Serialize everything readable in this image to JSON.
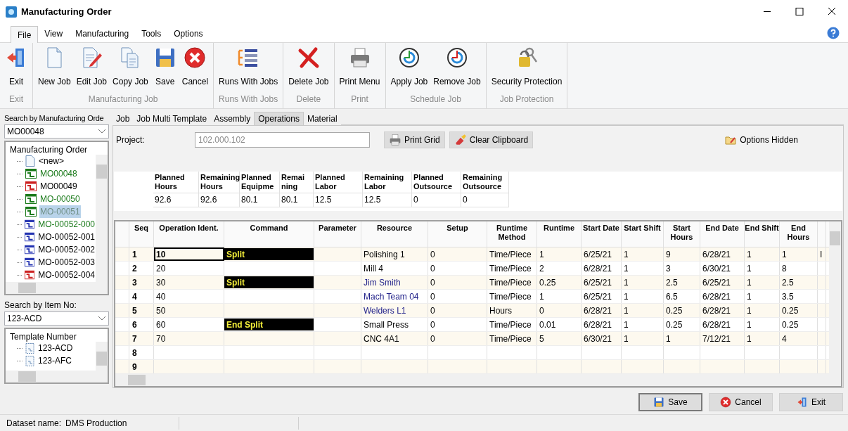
{
  "window": {
    "title": "Manufacturing Order"
  },
  "menu_tabs": [
    {
      "label": "File",
      "selected": true
    },
    {
      "label": "View",
      "selected": false
    },
    {
      "label": "Manufacturing",
      "selected": false
    },
    {
      "label": "Tools",
      "selected": false
    },
    {
      "label": "Options",
      "selected": false
    }
  ],
  "ribbon_groups": [
    {
      "title": "Exit",
      "buttons": [
        {
          "label": "Exit",
          "kind": "exit"
        }
      ]
    },
    {
      "title": "Manufacturing Job",
      "buttons": [
        {
          "label": "New Job",
          "kind": "new"
        },
        {
          "label": "Edit Job",
          "kind": "edit"
        },
        {
          "label": "Copy Job",
          "kind": "copy"
        },
        {
          "label": "Save",
          "kind": "save"
        },
        {
          "label": "Cancel",
          "kind": "cancel"
        }
      ]
    },
    {
      "title": "Runs With Jobs",
      "buttons": [
        {
          "label": "Runs With Jobs",
          "kind": "runs"
        }
      ]
    },
    {
      "title": "Delete",
      "buttons": [
        {
          "label": "Delete Job",
          "kind": "delete"
        }
      ]
    },
    {
      "title": "Print",
      "buttons": [
        {
          "label": "Print Menu",
          "kind": "print"
        }
      ]
    },
    {
      "title": "Schedule Job",
      "buttons": [
        {
          "label": "Apply Job",
          "kind": "apply"
        },
        {
          "label": "Remove Job",
          "kind": "remove"
        }
      ]
    },
    {
      "title": "Job Protection",
      "buttons": [
        {
          "label": "Security Protection",
          "kind": "security"
        }
      ]
    }
  ],
  "sidebar": {
    "order_search": {
      "label": "Search by Manufacturing Orde",
      "value": "MO00048"
    },
    "order_tree": {
      "title": "Manufacturing Order",
      "items": [
        {
          "label": "<new>",
          "kind": "new",
          "selected": false,
          "highlighted": false
        },
        {
          "label": "MO00048",
          "kind": "order",
          "color": "#1a7a1a",
          "selected": false,
          "highlighted": true
        },
        {
          "label": "MO00049",
          "kind": "order",
          "color": "#cc1f1f",
          "selected": false,
          "highlighted": false
        },
        {
          "label": "MO-00050",
          "kind": "order",
          "color": "#1a7a1a",
          "selected": false,
          "highlighted": true
        },
        {
          "label": "MO-00051",
          "kind": "order",
          "color": "#1a7a1a",
          "selected": true,
          "highlighted": true
        },
        {
          "label": "MO-00052-000",
          "kind": "order",
          "color": "#1f2fb0",
          "selected": false,
          "highlighted": true
        },
        {
          "label": "MO-00052-001",
          "kind": "order",
          "color": "#1f2fb0",
          "selected": false,
          "highlighted": false
        },
        {
          "label": "MO-00052-002",
          "kind": "order",
          "color": "#1f2fb0",
          "selected": false,
          "highlighted": false
        },
        {
          "label": "MO-00052-003",
          "kind": "order",
          "color": "#1f2fb0",
          "selected": false,
          "highlighted": false
        },
        {
          "label": "MO-00052-004",
          "kind": "order",
          "color": "#cc1f1f",
          "selected": false,
          "highlighted": false
        }
      ]
    },
    "item_search": {
      "label": "Search by Item No:",
      "value": "123-ACD"
    },
    "template_tree": {
      "title": "Template Number",
      "items": [
        "123-ACD",
        "123-AFC"
      ]
    }
  },
  "tabs": [
    {
      "label": "Job",
      "selected": false
    },
    {
      "label": "Job Multi Template",
      "selected": false
    },
    {
      "label": "Assembly",
      "selected": false
    },
    {
      "label": "Operations",
      "selected": true
    },
    {
      "label": "Material",
      "selected": false
    }
  ],
  "project": {
    "label": "Project:",
    "placeholder": "102.000.102"
  },
  "toolbar_buttons": [
    {
      "label": "Print Grid",
      "kind": "print"
    },
    {
      "label": "Clear Clipboard",
      "kind": "clear"
    }
  ],
  "options_link": "Options Hidden",
  "summary": {
    "columns": [
      "Planned Hours",
      "Remaining Hours",
      "Planned Equipme",
      "Remai ning",
      "Planned Labor",
      "Remaining Labor",
      "Planned Outsource",
      "Remaining Outsource"
    ],
    "values": [
      "92.6",
      "92.6",
      "80.1",
      "80.1",
      "12.5",
      "12.5",
      "0",
      "0"
    ]
  },
  "grid": {
    "columns": [
      "Seq",
      "Operation Ident.",
      "Command",
      "Parameter",
      "Resource",
      "Setup",
      "Runtime Method",
      "Runtime",
      "Start Date",
      "Start Shift",
      "Start Hours",
      "End Date",
      "End Shift",
      "End Hours"
    ],
    "rows": [
      {
        "selected": true,
        "color": "#000000",
        "cells": [
          "1",
          "10",
          "Split",
          null,
          "Polishing 1",
          "0",
          "Time/Piece",
          "1",
          "6/25/21",
          "1",
          "9",
          "6/28/21",
          "1",
          "1",
          "I"
        ]
      },
      {
        "selected": false,
        "color": "#000000",
        "cells": [
          "2",
          "20",
          null,
          null,
          "Mill 4",
          "0",
          "Time/Piece",
          "2",
          "6/28/21",
          "1",
          "3",
          "6/30/21",
          "1",
          "8"
        ]
      },
      {
        "selected": false,
        "color": "#22228a",
        "cells": [
          "3",
          "30",
          "Split",
          null,
          "Jim Smith",
          "0",
          "Time/Piece",
          "0.25",
          "6/25/21",
          "1",
          "2.5",
          "6/25/21",
          "1",
          "2.5"
        ]
      },
      {
        "selected": false,
        "color": "#22228a",
        "cells": [
          "4",
          "40",
          null,
          null,
          "Mach Team 04",
          "0",
          "Time/Piece",
          "1",
          "6/25/21",
          "1",
          "6.5",
          "6/28/21",
          "1",
          "3.5"
        ]
      },
      {
        "selected": false,
        "color": "#22228a",
        "cells": [
          "5",
          "50",
          null,
          null,
          "Welders L1",
          "0",
          "Hours",
          "0",
          "6/28/21",
          "1",
          "0.25",
          "6/28/21",
          "1",
          "0.25"
        ]
      },
      {
        "selected": false,
        "color": "#000000",
        "cells": [
          "6",
          "60",
          "End Split",
          null,
          "Small Press",
          "0",
          "Time/Piece",
          "0.01",
          "6/28/21",
          "1",
          "0.25",
          "6/28/21",
          "1",
          "0.25"
        ]
      },
      {
        "selected": false,
        "color": "#000000",
        "cells": [
          "7",
          "70",
          null,
          null,
          "CNC 4A1",
          "0",
          "Time/Piece",
          "5",
          "6/30/21",
          "1",
          "1",
          "7/12/21",
          "1",
          "4"
        ]
      },
      {
        "selected": false,
        "cells": [
          "8"
        ]
      },
      {
        "selected": false,
        "cells": [
          "9"
        ]
      }
    ]
  },
  "footer_buttons": [
    {
      "label": "Save",
      "kind": "save",
      "focused": true
    },
    {
      "label": "Cancel",
      "kind": "cancel",
      "focused": false
    },
    {
      "label": "Exit",
      "kind": "exit",
      "focused": false
    }
  ],
  "status_bar": {
    "label": "Dataset name:",
    "value": "DMS Production"
  }
}
